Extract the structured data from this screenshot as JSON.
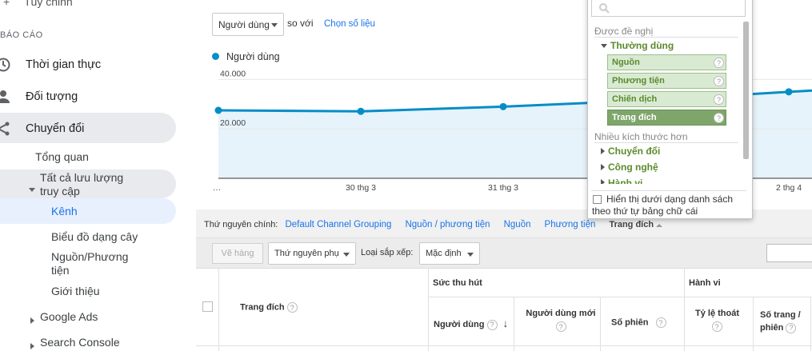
{
  "sidebar": {
    "top_item": "Tùy chỉnh",
    "section": "BÁO CÁO",
    "items": [
      {
        "label": "Thời gian thực"
      },
      {
        "label": "Đối tượng"
      },
      {
        "label": "Chuyển đổi"
      }
    ],
    "sub": {
      "overview": "Tổng quan",
      "all_traffic_1": "Tất cả lưu lượng",
      "all_traffic_2": "truy cập",
      "channels": "Kênh",
      "treemap": "Biểu đồ dạng cây",
      "source_medium_1": "Nguồn/Phương",
      "source_medium_2": "tiện",
      "referrals": "Giới thiệu",
      "google_ads": "Google Ads",
      "search_console": "Search Console"
    }
  },
  "chart_controls": {
    "metric_select": "Người dùng",
    "vs_text": "so với",
    "choose_metric": "Chọn số liệu",
    "legend": "Người dùng"
  },
  "chart_data": {
    "type": "line",
    "categories": [
      "…",
      "30 thg 3",
      "31 thg 3",
      "1 thg 4",
      "2 thg 4"
    ],
    "tick_labels": [
      "…",
      "30 thg 3",
      "31 thg 3",
      "2 thg 4"
    ],
    "series": [
      {
        "name": "Người dùng",
        "values": [
          27500,
          27100,
          29000,
          31500,
          35000,
          35500
        ]
      }
    ],
    "y_ticks": [
      "40.000",
      "20.000"
    ],
    "ylim": [
      0,
      44000
    ],
    "color": "#058dc7",
    "fill": "#e6f3fa"
  },
  "dimension_bar": {
    "label": "Thứ nguyên chính:",
    "options": [
      "Default Channel Grouping",
      "Nguồn / phương tiện",
      "Nguồn",
      "Phương tiện"
    ],
    "active": "Trang đích"
  },
  "toolbar": {
    "plot_rows": "Vẽ hàng",
    "secondary_dim": "Thứ nguyên phụ",
    "sort_label": "Loại sắp xếp:",
    "sort_value": "Mặc định"
  },
  "table": {
    "col_landing": "Trang đích",
    "group_acquisition": "Sức thu hút",
    "group_behavior": "Hành vi",
    "col_users": "Người dùng",
    "col_new_users": "Người dùng mới",
    "col_sessions": "Số phiên",
    "col_bounce": "Tỷ lệ thoát",
    "col_pages_1": "Số trang /",
    "col_pages_2": "phiên",
    "qm": "?"
  },
  "popup": {
    "suggested": "Được đề nghị",
    "frequent": "Thường dùng",
    "items": [
      {
        "label": "Nguồn"
      },
      {
        "label": "Phương tiện"
      },
      {
        "label": "Chiến dịch"
      },
      {
        "label": "Trang đích"
      }
    ],
    "more": "Nhiều kích thước hơn",
    "groups": [
      "Chuyển đổi",
      "Công nghệ",
      "Hành vi"
    ],
    "checkbox_1": "Hiển thị dưới dạng danh sách",
    "checkbox_2": "theo thứ tự bảng chữ cái"
  }
}
